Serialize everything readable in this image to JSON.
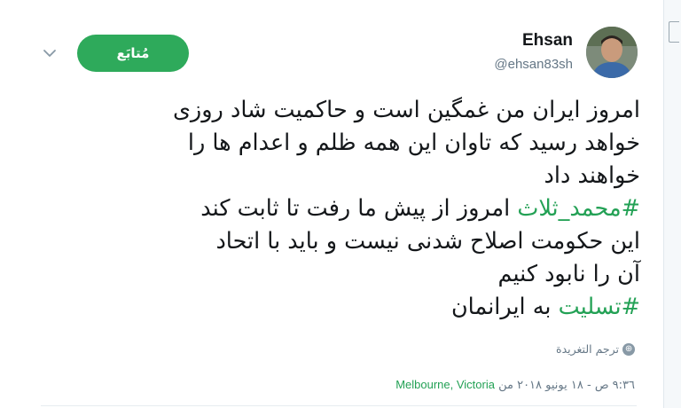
{
  "user": {
    "name": "Ehsan",
    "handle": "@ehsan83sh"
  },
  "follow_button": {
    "label": "مُتابَع"
  },
  "tweet": {
    "lines": [
      [
        {
          "text": "امروز ایران من غمگین است و حاکمیت شاد روزی",
          "hashtag": false
        }
      ],
      [
        {
          "text": "خواهد رسید که تاوان این همه ظلم و اعدام ها را",
          "hashtag": false
        }
      ],
      [
        {
          "text": "خواهند داد",
          "hashtag": false
        }
      ],
      [
        {
          "text": "#محمد_ثلاث",
          "hashtag": true
        },
        {
          "text": "  امروز از پیش ما رفت تا ثابت کند",
          "hashtag": false
        }
      ],
      [
        {
          "text": "این حکومت اصلاح شدنی نیست و باید با اتحاد",
          "hashtag": false
        }
      ],
      [
        {
          "text": "آن را نابود کنیم",
          "hashtag": false
        }
      ],
      [
        {
          "text": "#تسلیت",
          "hashtag": true
        },
        {
          "text": " به ایرانمان",
          "hashtag": false
        }
      ]
    ]
  },
  "translate": {
    "label": "ترجم التغريدة",
    "icon": "globe-icon"
  },
  "meta": {
    "time_date": "٩:٣٦ ص - ١٨ يونيو ٢٠١٨ من ",
    "location": "Melbourne, Victoria"
  },
  "colors": {
    "accent": "#2eaa5b",
    "hashtag": "#23a155",
    "muted": "#657786"
  }
}
